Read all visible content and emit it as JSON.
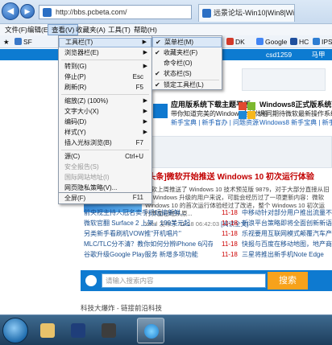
{
  "browser": {
    "address": "http://bbs.pcbeta.com/",
    "tab_title": "远景论坛-Win10|Win8|Win..."
  },
  "menubar": [
    "文件(F)",
    "编辑(E)",
    "查看(V)",
    "收藏夹(A)",
    "工具(T)",
    "帮助(H)"
  ],
  "favorites": {
    "left": "SF",
    "items": [
      "DK",
      "Google",
      "HC",
      "IPS"
    ]
  },
  "view_menu": {
    "items": [
      {
        "label": "工具栏(T)",
        "shortcut": "",
        "arrow": "▶",
        "disabled": false
      },
      {
        "label": "浏览器栏(E)",
        "shortcut": "",
        "arrow": "▶",
        "disabled": false
      },
      {
        "label": "转到(G)",
        "shortcut": "",
        "arrow": "▶",
        "disabled": false
      },
      {
        "label": "停止(P)",
        "shortcut": "Esc",
        "arrow": "",
        "disabled": false
      },
      {
        "label": "刷新(R)",
        "shortcut": "F5",
        "arrow": "",
        "disabled": false
      },
      {
        "label": "缩放(Z) (100%)",
        "shortcut": "",
        "arrow": "▶",
        "disabled": false
      },
      {
        "label": "文字大小(X)",
        "shortcut": "",
        "arrow": "▶",
        "disabled": false
      },
      {
        "label": "编码(D)",
        "shortcut": "",
        "arrow": "▶",
        "disabled": false
      },
      {
        "label": "样式(Y)",
        "shortcut": "",
        "arrow": "▶",
        "disabled": false
      },
      {
        "label": "插入光标浏览(B)",
        "shortcut": "F7",
        "arrow": "",
        "disabled": false
      },
      {
        "label": "源(C)",
        "shortcut": "Ctrl+U",
        "arrow": "",
        "disabled": false
      },
      {
        "label": "安全报告(S)",
        "shortcut": "",
        "arrow": "",
        "disabled": true
      },
      {
        "label": "国际网站地址(I)",
        "shortcut": "",
        "arrow": "",
        "disabled": true
      },
      {
        "label": "网页隐私策略(V)...",
        "shortcut": "",
        "arrow": "",
        "disabled": false
      },
      {
        "label": "全屏(F)",
        "shortcut": "F11",
        "arrow": "",
        "disabled": false
      }
    ]
  },
  "toolbars_submenu": {
    "items": [
      {
        "label": "菜单栏(M)",
        "checked": true
      },
      {
        "label": "收藏夹栏(F)",
        "checked": true
      },
      {
        "label": "命令栏(O)",
        "checked": false
      },
      {
        "label": "状态栏(S)",
        "checked": true
      },
      {
        "label": "锁定工具栏(L)",
        "checked": true
      }
    ]
  },
  "site": {
    "user": "csd1259",
    "user_links": [
      "马甲",
      "提醒"
    ],
    "promo_left_title": "应用版系统下载主题平板",
    "promo_left_sub": "带你知道完美的Windows全新体验",
    "promo_left_link": "新手宝典 | 新手盲办 | 问题资源",
    "promo_right_title": "Windows8正式版系统下载",
    "promo_right_sub": "共同期待微软最新操作系统，优化",
    "promo_right_link": "Windows8 新手宝典 | 新手盲办",
    "headline": "[头条]微软开始推送 Windows 10 初次运行体验",
    "summary": "微软上周推送了 Windows 10 技术预览版 9879，对于大部分直接从旧版 Windows 升级的用户来说，可能会经历过了一项更新内容：微软 Windows 10 的首次运行体验经过了改进，整个 Windows 10 初次运行界面已经从原...",
    "meta": "xchtl 发布于 11-18 06:42:03",
    "read_more": "[阅读全文]",
    "news": [
      {
        "title": "前央视主持人冠名卖手机玩搞新鲜...",
        "date": "11-18",
        "right": "中移动针对部分用户推出流量不清零服"
      },
      {
        "title": "微软官翻 Surface 2 上架，199美元起",
        "date": "11-18",
        "right": "新浪平台策略即将全面创新新语言"
      },
      {
        "title": "另类新手看刷机VOW推\"开机唱片\"",
        "date": "11-18",
        "right": "乐视要用互联网模式颠覆汽车产业"
      },
      {
        "title": "MLC/TLC分不清？教你如何分辨iPhone 6闪存类型",
        "date": "11-18",
        "right": "快报与百度在移动地图，地产商不再"
      },
      {
        "title": "谷歌升级Google Play服务 新增多项功能",
        "date": "11-18",
        "right": "三星将推出新手机Note Edge"
      }
    ],
    "search_placeholder": "请输入搜索内容",
    "search_button": "搜索",
    "footer_text": "科技大爆炸 - 链接前沿科技"
  }
}
